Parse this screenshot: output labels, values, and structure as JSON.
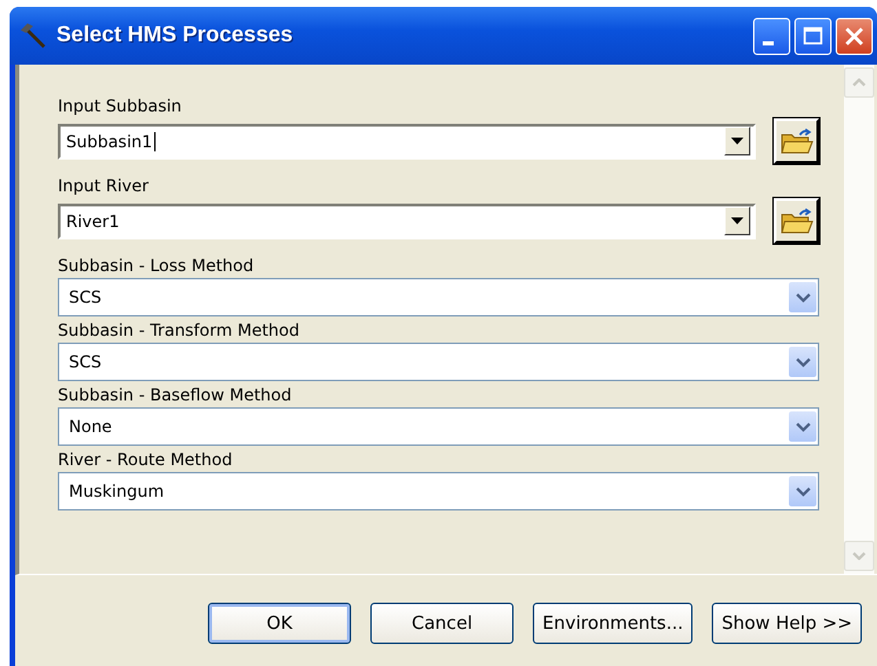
{
  "window": {
    "title": "Select HMS Processes"
  },
  "fields": [
    {
      "kind": "combo_browse",
      "label": "Input Subbasin",
      "value": "Subbasin1"
    },
    {
      "kind": "combo_browse",
      "label": "Input River",
      "value": "River1"
    },
    {
      "kind": "dropdown",
      "label": "Subbasin - Loss Method",
      "value": "SCS"
    },
    {
      "kind": "dropdown",
      "label": "Subbasin - Transform Method",
      "value": "SCS"
    },
    {
      "kind": "dropdown",
      "label": "Subbasin - Baseflow Method",
      "value": "None"
    },
    {
      "kind": "dropdown",
      "label": "River - Route Method",
      "value": "Muskingum"
    }
  ],
  "buttons": [
    {
      "label": "OK",
      "selected": true
    },
    {
      "label": "Cancel",
      "selected": false
    },
    {
      "label": "Environments...",
      "selected": false
    },
    {
      "label": "Show Help >>",
      "selected": false
    }
  ]
}
